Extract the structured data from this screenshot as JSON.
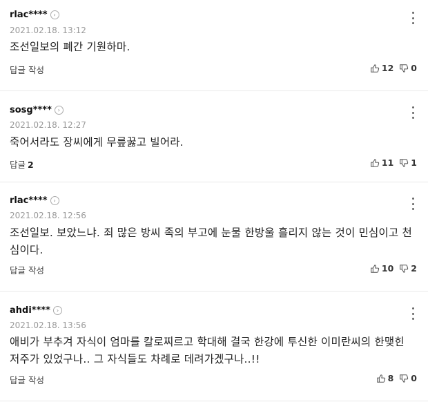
{
  "comments": [
    {
      "author": "rlac****",
      "date": "2021.02.18. 13:12",
      "text": "조선일보의 폐간 기원하마.",
      "reply_label": "답글 작성",
      "reply_count": "",
      "likes": "12",
      "dislikes": "0"
    },
    {
      "author": "sosg****",
      "date": "2021.02.18. 12:27",
      "text": "죽어서라도 장씨에게 무릎꿇고 빌어라.",
      "reply_label": "답글",
      "reply_count": "2",
      "likes": "11",
      "dislikes": "1"
    },
    {
      "author": "rlac****",
      "date": "2021.02.18. 12:56",
      "text": "조선일보. 보았느냐. 죄 많은 방씨 족의 부고에 눈물 한방울 흘리지 않는 것이 민심이고 천심이다.",
      "reply_label": "답글 작성",
      "reply_count": "",
      "likes": "10",
      "dislikes": "2"
    },
    {
      "author": "ahdi****",
      "date": "2021.02.18. 13:56",
      "text": "애비가 부추겨 자식이 엄마를 칼로찌르고 학대해 결국 한강에 투신한 이미란씨의 한맺힌 저주가 있었구나.. 그 자식들도 차례로 데려가겠구나..!!",
      "reply_label": "답글 작성",
      "reply_count": "",
      "likes": "8",
      "dislikes": "0"
    }
  ],
  "icons": {
    "profile": "chevron-right-icon",
    "more": "more-vertical-icon",
    "like": "thumbs-up-icon",
    "dislike": "thumbs-down-icon"
  }
}
